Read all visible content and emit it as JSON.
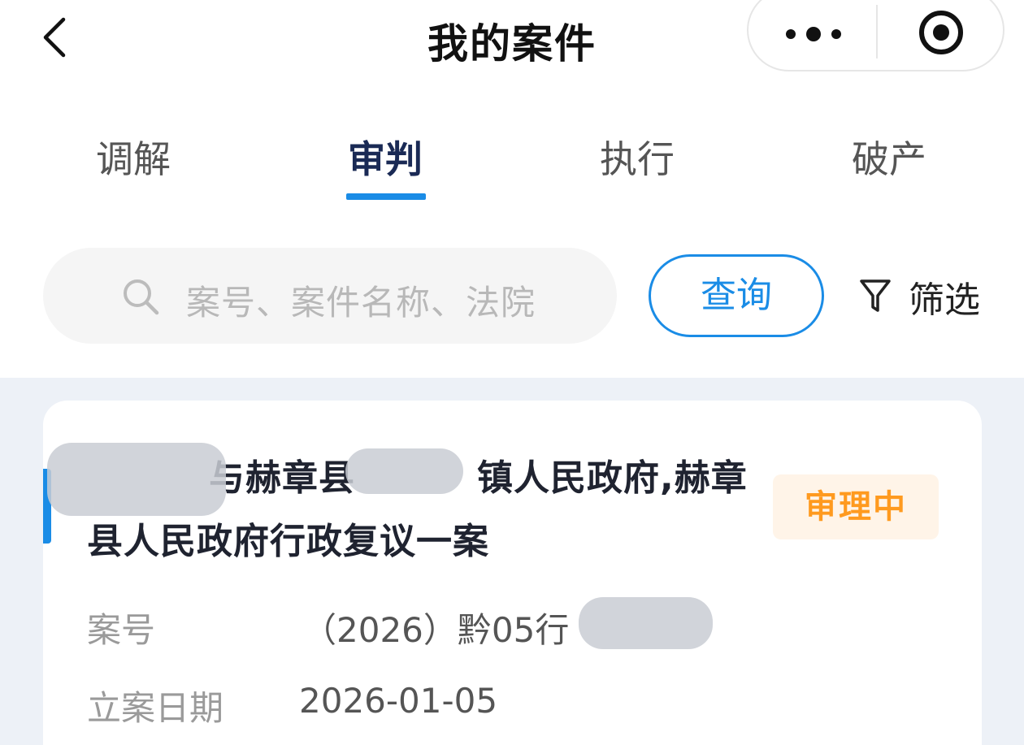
{
  "nav": {
    "title": "我的案件"
  },
  "tabs": [
    {
      "label": "调解"
    },
    {
      "label": "审判"
    },
    {
      "label": "执行"
    },
    {
      "label": "破产"
    }
  ],
  "search": {
    "placeholder": "案号、案件名称、法院",
    "query_button": "查询",
    "filter_label": "筛选"
  },
  "colors": {
    "accent": "#1a8ce6",
    "status_text": "#ff9a1f",
    "status_bg": "#fff4e8",
    "page_bg": "#edf1f7"
  },
  "case": {
    "title_part1": "与赫章县",
    "title_part2": "镇人民政府,赫章",
    "title_line2": "县人民政府行政复议一案",
    "status": "审理中",
    "case_no_label": "案号",
    "case_no_value": "（2026）黔05行",
    "filing_date_label": "立案日期",
    "filing_date_value": "2026-01-05"
  },
  "icons": [
    "back-arrow-icon",
    "more-dots-icon",
    "close-target-icon",
    "search-icon",
    "filter-funnel-icon"
  ]
}
